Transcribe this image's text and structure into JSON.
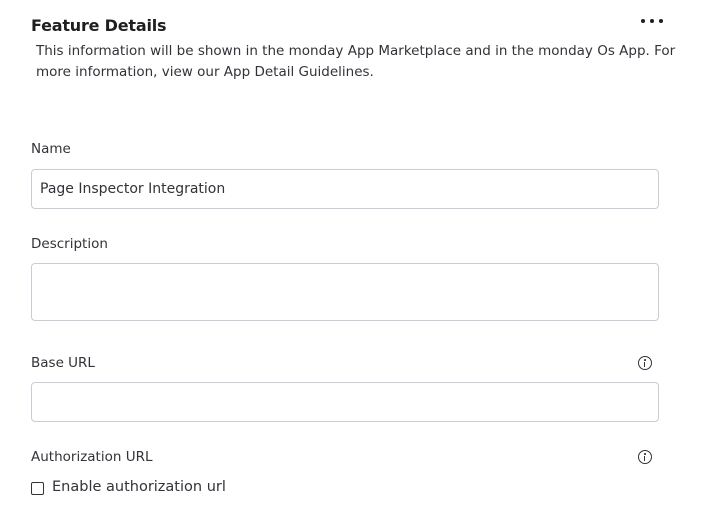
{
  "section": {
    "title": "Feature Details",
    "description": "This information will be shown in the monday App Marketplace and in the monday Os App. For more information, view our App Detail Guidelines."
  },
  "icons": {
    "more": "more-horizontal-icon",
    "info": "info-icon"
  },
  "fields": {
    "name": {
      "label": "Name",
      "value": "Page Inspector Integration",
      "placeholder": ""
    },
    "description": {
      "label": "Description",
      "value": "",
      "placeholder": ""
    },
    "base_url": {
      "label": "Base URL",
      "value": "",
      "placeholder": ""
    },
    "authorization_url": {
      "label": "Authorization URL",
      "checkbox_label": "Enable authorization url",
      "checked": false
    }
  }
}
